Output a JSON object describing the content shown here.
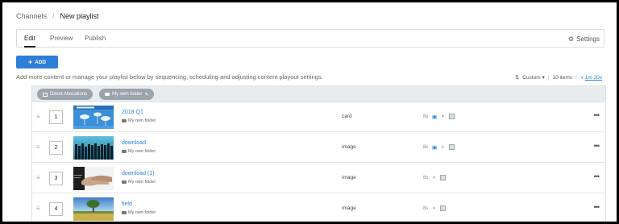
{
  "breadcrumb": {
    "parent": "Channels",
    "separator": "/",
    "current": "New playlist"
  },
  "tabs": [
    {
      "label": "Edit",
      "active": true
    },
    {
      "label": "Preview"
    },
    {
      "label": "Publish"
    }
  ],
  "settings_label": "Settings",
  "add_button_label": "ADD",
  "help_text": "Add more content or manage your playlist below by sequencing, scheduling and adjusting content playout settings.",
  "meta": {
    "sort": "Custom",
    "items": "10 items",
    "duration": "1m 20s"
  },
  "filters": [
    {
      "label": "Direct Allocations"
    },
    {
      "label": "My own folder"
    }
  ],
  "rows": [
    {
      "position": "1",
      "title": "2018 Q1",
      "folder": "My own folder",
      "type": "card",
      "duration": "8s",
      "scheduled": true
    },
    {
      "position": "2",
      "title": "download",
      "folder": "My own folder",
      "type": "image",
      "duration": "8s",
      "scheduled": true
    },
    {
      "position": "3",
      "title": "download (1)",
      "folder": "My own folder",
      "type": "image",
      "duration": "8s",
      "scheduled": false
    },
    {
      "position": "4",
      "title": "field",
      "folder": "My own folder",
      "type": "image",
      "duration": "8s",
      "scheduled": false
    }
  ],
  "colors": {
    "accent": "#2d7fd8",
    "chip": "#9aa4ad",
    "filter_bar": "#e8ecef"
  },
  "icons": {
    "settings": "gear-icon",
    "sort": "sort-icon",
    "duration": "half-circle-icon",
    "edit": "pencil-icon",
    "folder": "folder-icon",
    "image": "image-icon",
    "row_menu": "ellipsis-icon",
    "drag": "drag-handle-icon"
  }
}
